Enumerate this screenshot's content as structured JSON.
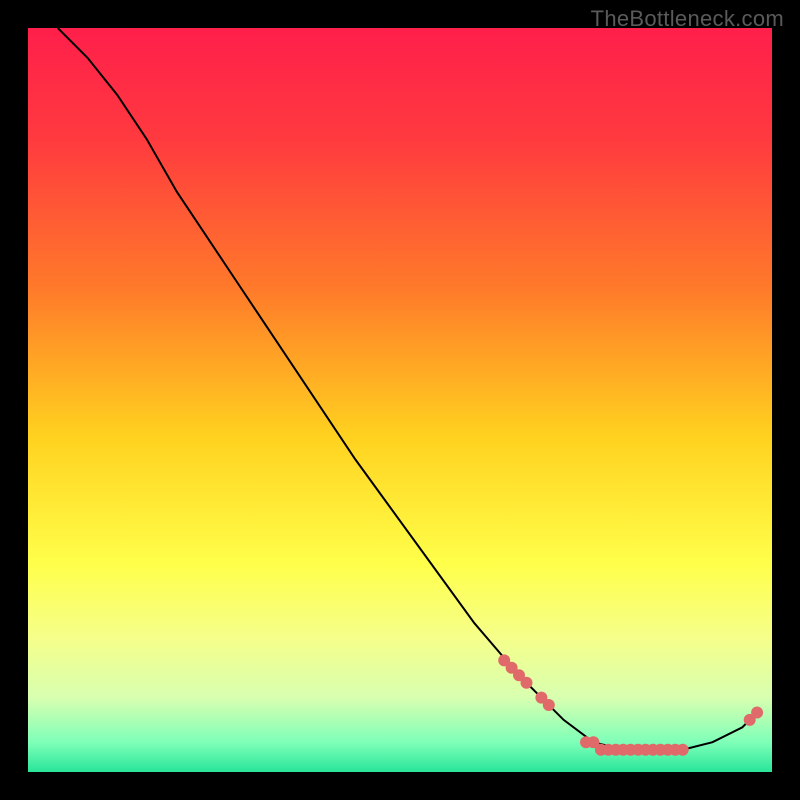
{
  "watermark": "TheBottleneck.com",
  "chart_data": {
    "type": "line",
    "title": "",
    "xlabel": "",
    "ylabel": "",
    "xlim": [
      0,
      100
    ],
    "ylim": [
      0,
      100
    ],
    "background_gradient": {
      "stops": [
        {
          "pos": 0.0,
          "color": "#ff1f4b"
        },
        {
          "pos": 0.15,
          "color": "#ff3a3f"
        },
        {
          "pos": 0.35,
          "color": "#ff7a2a"
        },
        {
          "pos": 0.55,
          "color": "#ffd21f"
        },
        {
          "pos": 0.72,
          "color": "#ffff4a"
        },
        {
          "pos": 0.82,
          "color": "#f5ff8a"
        },
        {
          "pos": 0.9,
          "color": "#d8ffb0"
        },
        {
          "pos": 0.96,
          "color": "#7fffb8"
        },
        {
          "pos": 1.0,
          "color": "#28e59a"
        }
      ]
    },
    "series": [
      {
        "name": "bottleneck-curve",
        "color": "#000000",
        "points": [
          {
            "x": 4,
            "y": 100
          },
          {
            "x": 8,
            "y": 96
          },
          {
            "x": 12,
            "y": 91
          },
          {
            "x": 16,
            "y": 85
          },
          {
            "x": 20,
            "y": 78
          },
          {
            "x": 28,
            "y": 66
          },
          {
            "x": 36,
            "y": 54
          },
          {
            "x": 44,
            "y": 42
          },
          {
            "x": 52,
            "y": 31
          },
          {
            "x": 60,
            "y": 20
          },
          {
            "x": 66,
            "y": 13
          },
          {
            "x": 72,
            "y": 7
          },
          {
            "x": 76,
            "y": 4
          },
          {
            "x": 80,
            "y": 3
          },
          {
            "x": 84,
            "y": 3
          },
          {
            "x": 88,
            "y": 3
          },
          {
            "x": 92,
            "y": 4
          },
          {
            "x": 96,
            "y": 6
          },
          {
            "x": 98,
            "y": 8
          }
        ]
      }
    ],
    "markers": {
      "name": "highlight-dots",
      "color": "#e06a6a",
      "radius": 6,
      "points": [
        {
          "x": 64,
          "y": 15
        },
        {
          "x": 65,
          "y": 14
        },
        {
          "x": 66,
          "y": 13
        },
        {
          "x": 67,
          "y": 12
        },
        {
          "x": 69,
          "y": 10
        },
        {
          "x": 70,
          "y": 9
        },
        {
          "x": 75,
          "y": 4
        },
        {
          "x": 76,
          "y": 4
        },
        {
          "x": 77,
          "y": 3
        },
        {
          "x": 78,
          "y": 3
        },
        {
          "x": 79,
          "y": 3
        },
        {
          "x": 80,
          "y": 3
        },
        {
          "x": 81,
          "y": 3
        },
        {
          "x": 82,
          "y": 3
        },
        {
          "x": 83,
          "y": 3
        },
        {
          "x": 84,
          "y": 3
        },
        {
          "x": 85,
          "y": 3
        },
        {
          "x": 86,
          "y": 3
        },
        {
          "x": 87,
          "y": 3
        },
        {
          "x": 88,
          "y": 3
        },
        {
          "x": 97,
          "y": 7
        },
        {
          "x": 98,
          "y": 8
        }
      ]
    }
  }
}
